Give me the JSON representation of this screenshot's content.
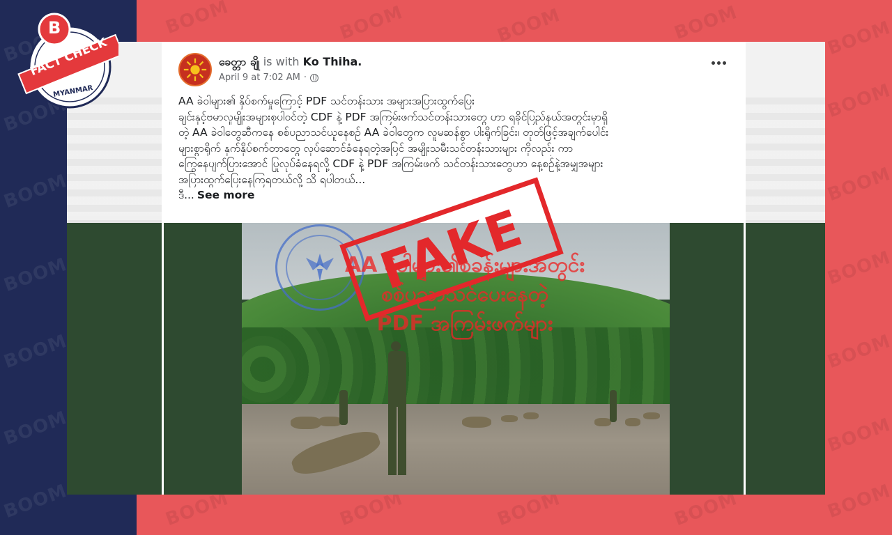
{
  "watermark": {
    "text": "BOOM"
  },
  "badge": {
    "line1": "FACT CHECK",
    "line2": "MYANMAR",
    "letter": "B"
  },
  "post": {
    "author": "ခေတ္တာ ချို",
    "with_text": "is with",
    "tagged": "Ko Thiha",
    "timestamp": "April 9 at 7:02 AM",
    "privacy_icon": "globe-icon",
    "more_icon": "more-icon",
    "body_lines": [
      "AA ခဲဝါများ၏ နှိပ်စက်မှုကြောင့် PDF သင်တန်းသား အများအပြားထွက်ပြေး",
      "ချင်းနှင့်ဗမာလူမျိုးအများစုပါဝင်တဲ့ CDF နဲ့ PDF အကြမ်းဖက်သင်တန်းသားတွေ ဟာ ရခိုင်ပြည်နယ်အတွင်းမှာရှိ",
      "တဲ့ AA ခဲဝါတွေဆီကနေ စစ်ပညာသင်ယူနေစဉ် AA ခဲဝါတွေက လူမဆန်စွာ ပါးရိုက်ခြင်း၊ တုတ်ဖြင့်အချက်ပေါင်း",
      "များစွာရိုက် နှက်နှိပ်စက်တာတွေ လုပ်ဆောင်ခံနေရတဲ့အပြင် အမျိုးသမီးသင်တန်းသားများ ကိုလည်း ကာ",
      "ကြွေနေပျက်ပြားအောင် ပြုလုပ်ခံနေရလို့ CDF နဲ့ PDF အကြမ်းဖက် သင်တန်းသားတွေဟာ နေ့စဉ်နဲ့အမျှအများ",
      "အပြားထွက်ပြေးနေကြရတယ်လို့ သိ ရပါတယ်..."
    ],
    "truncated_line": "ဒီ...",
    "see_more": "See more"
  },
  "image": {
    "overlay_lines": [
      "AA ခဲဝါများ၏စခန်းများအတွင်း",
      "စစ်ပညာသင်ပေးနေတဲ့",
      "PDF အကြမ်းဖက်များ"
    ],
    "stamp": "FAKE"
  },
  "colors": {
    "left_band": "#202a57",
    "right_band": "#e8575a",
    "stamp": "#e3282b",
    "badge_red": "#e4393c",
    "badge_navy": "#202a57"
  }
}
